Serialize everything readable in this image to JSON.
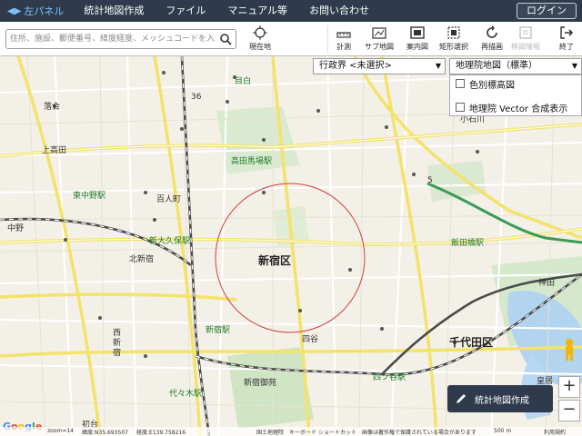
{
  "topbar": {
    "panel_toggle": "左パネル",
    "menu": [
      "統計地図作成",
      "ファイル",
      "マニュアル等",
      "お問い合わせ"
    ],
    "login": "ログイン"
  },
  "toolbar": {
    "search_placeholder": "住所、施設、郵便番号、緯度経度、メッシュコードを入力",
    "tools": {
      "current_location": "現在地",
      "measure": "計測",
      "sub_map": "サブ地図",
      "guide_map": "案内図",
      "rect_select": "矩形選択",
      "redraw": "再描画",
      "info_clear": "移図情報",
      "exit": "終了"
    }
  },
  "map": {
    "admin_dropdown": "行政界 <未選択>",
    "base_dropdown": "地理院地図（標準）",
    "layers": [
      "色別標高図",
      "地理院 Vector 合成表示"
    ],
    "labels": {
      "shinjuku_ku": "新宿区",
      "chiyoda_ku": "千代田区",
      "takadanobaba": "高田馬場駅",
      "higashi_nakano": "東中野駅",
      "shin_okubo": "新大久保駅",
      "iidabashi": "飯田橋駅",
      "shinjuku_st": "新宿駅",
      "yotsuya": "四ツ谷駅",
      "yoyogi": "代々木駅",
      "hyakunin": "百人町",
      "kitashinjuku": "北新宿",
      "nishishinjuku": "西新宿",
      "kamitakada": "上高田",
      "nakano": "中野",
      "ochiai": "落合",
      "mejiro": "目白",
      "koishikawa": "小石川",
      "kanda": "神田",
      "shinjuku_gyoen": "新宿御苑",
      "yotsuya2": "四谷",
      "hatsudai": "初台",
      "kojimachi": "皇居",
      "route36": "36",
      "route5": "5"
    }
  },
  "create_button": "統計地図作成",
  "zoom": {
    "in": "+",
    "out": "−"
  },
  "status": {
    "zoom": "zoom=14",
    "lat": "緯度:N35.693507",
    "lng": "経度:E139.758216",
    "attribution": "国土地理院",
    "shortcut": "キーボード ショートカット",
    "note": "画像は著作権で保護されている場合があります",
    "scale": "500 m",
    "terms": "利用規約"
  },
  "colors": {
    "topbar": "#2f3b4c",
    "accent": "#7fc4ff",
    "road_yellow": "#f3e36b",
    "rail": "#555555",
    "circle": "#d04040"
  }
}
